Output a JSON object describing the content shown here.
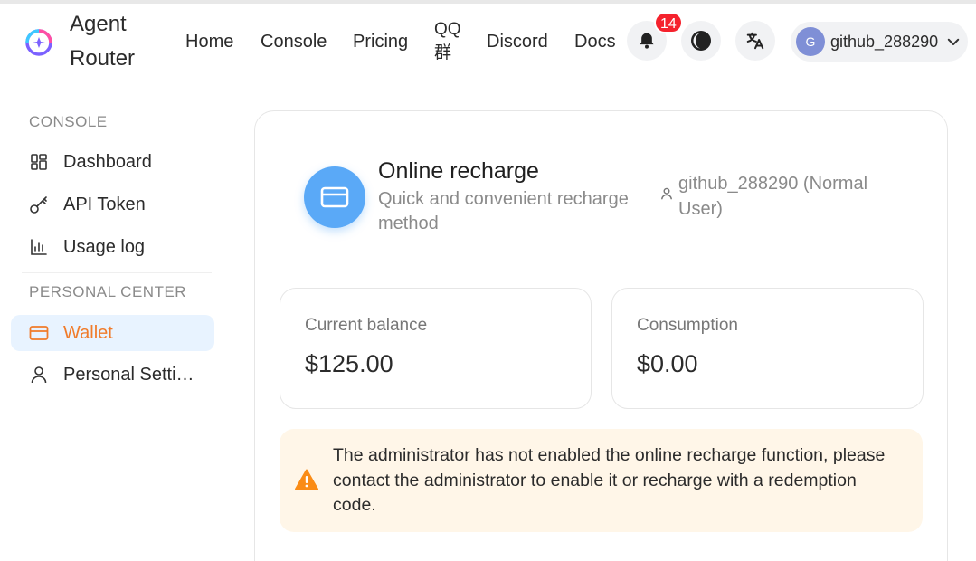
{
  "brand": {
    "name": "Agent Router"
  },
  "nav": {
    "home": "Home",
    "console": "Console",
    "pricing": "Pricing",
    "qq": "QQ群",
    "discord": "Discord",
    "docs": "Docs"
  },
  "notifications": {
    "count": "14"
  },
  "user": {
    "initial": "G",
    "name": "github_288290"
  },
  "sidebar": {
    "console_title": "CONSOLE",
    "items": [
      {
        "label": "Dashboard",
        "icon": "dashboard-icon"
      },
      {
        "label": "API Token",
        "icon": "key-icon"
      },
      {
        "label": "Usage log",
        "icon": "bar-chart-icon"
      }
    ],
    "personal_title": "PERSONAL CENTER",
    "personal_items": [
      {
        "label": "Wallet",
        "icon": "wallet-icon",
        "active": true
      },
      {
        "label": "Personal Settings",
        "icon": "user-icon"
      }
    ]
  },
  "recharge": {
    "title": "Online recharge",
    "subtitle": "Quick and convenient recharge method",
    "user_info": "github_288290 (Normal User)"
  },
  "stats": {
    "balance_label": "Current balance",
    "balance_value": "$125.00",
    "consumption_label": "Consumption",
    "consumption_value": "$0.00"
  },
  "alert": {
    "message": "The administrator has not enabled the online recharge function, please contact the administrator to enable it or recharge with a redemption code."
  },
  "colors": {
    "accent_orange": "#f07b2a",
    "active_bg": "#e8f3ff",
    "pay_icon_bg": "#5aa9f7",
    "alert_bg": "#fff6e8",
    "warning": "#fa8c16",
    "badge": "#f5222d"
  }
}
